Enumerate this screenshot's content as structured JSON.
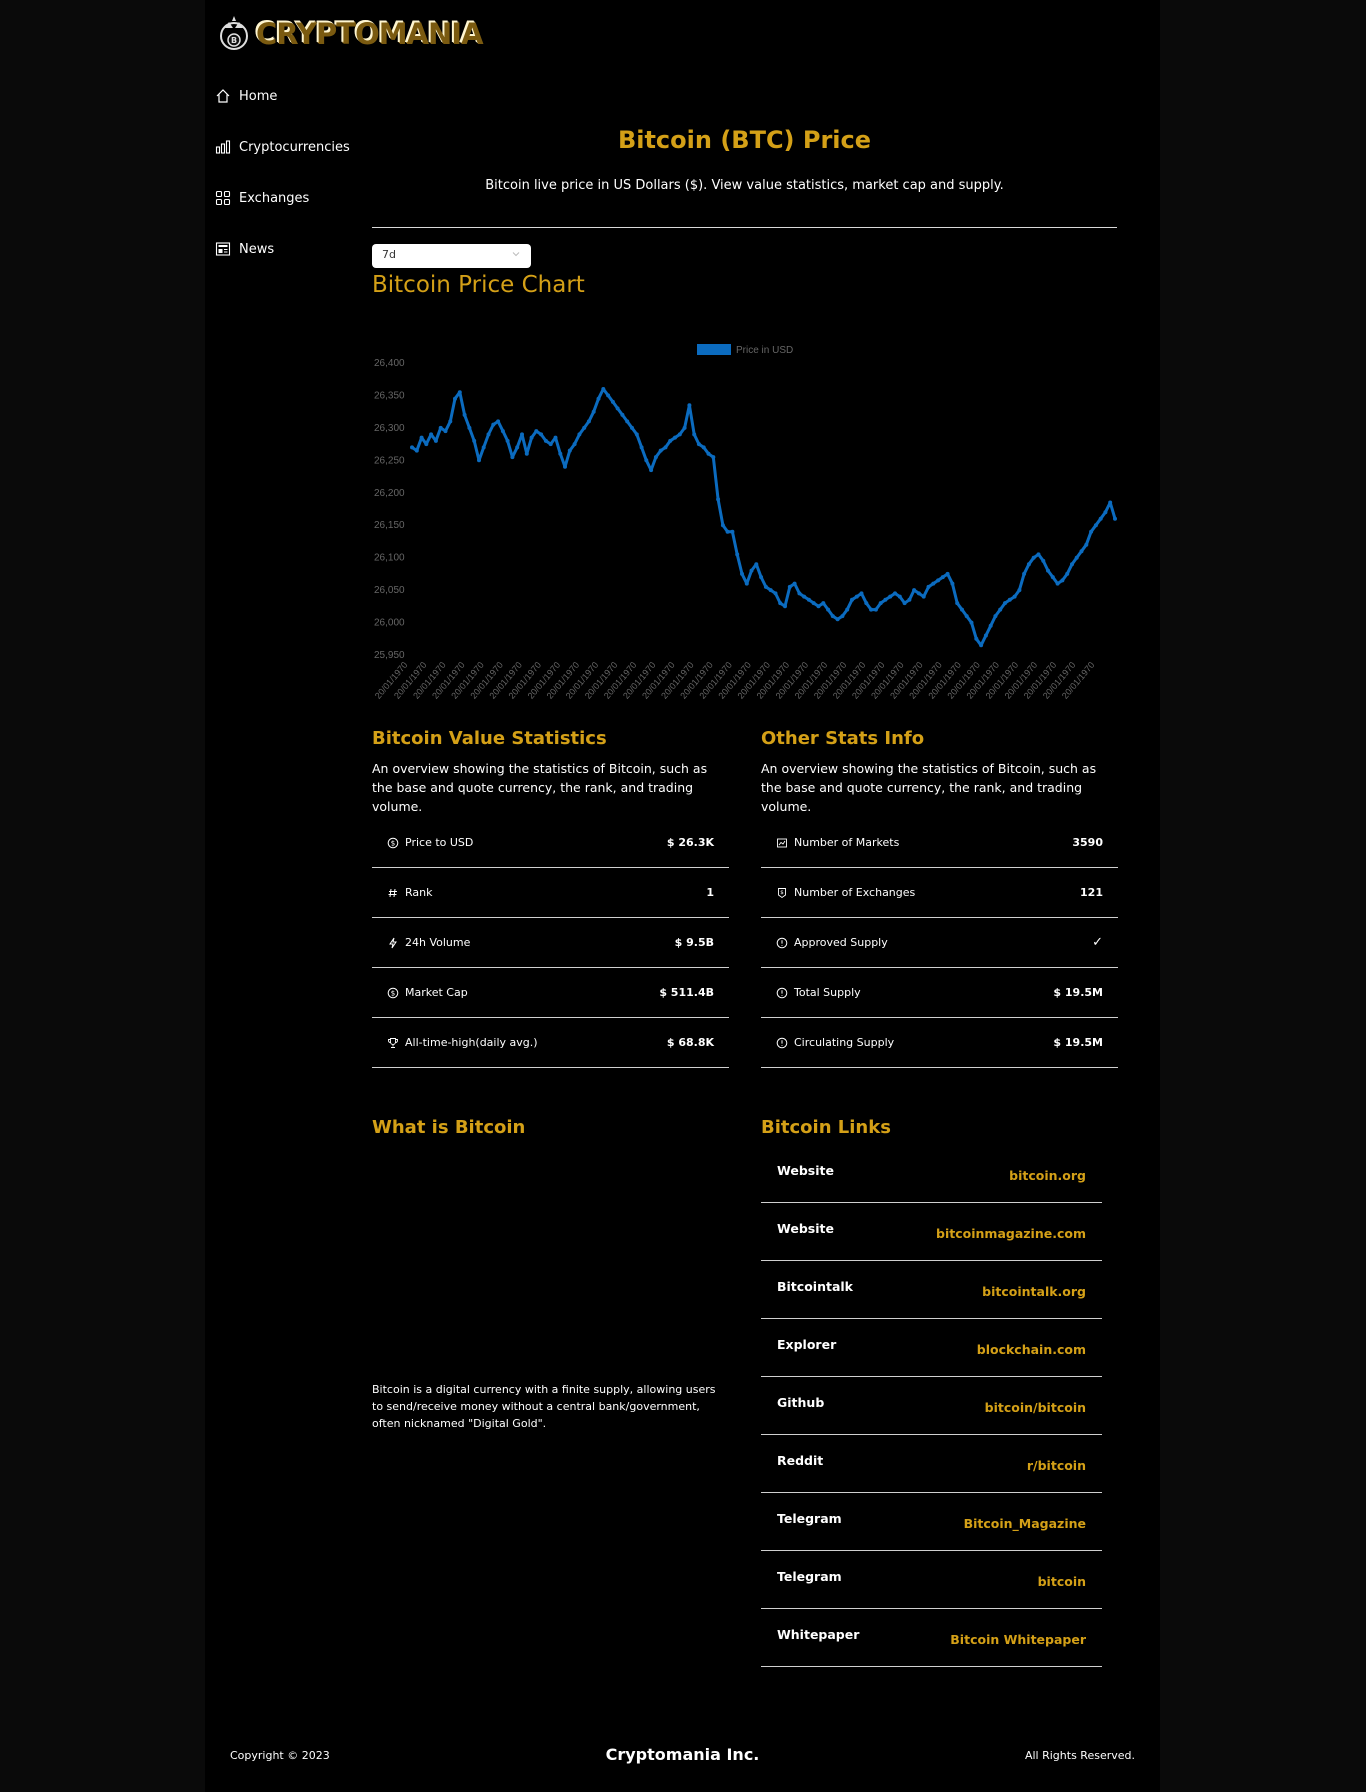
{
  "brand": {
    "logo_text": "CRYPTOMANIA"
  },
  "nav": [
    {
      "label": "Home",
      "icon": "home-icon"
    },
    {
      "label": "Cryptocurrencies",
      "icon": "bar-chart-icon"
    },
    {
      "label": "Exchanges",
      "icon": "grid-icon"
    },
    {
      "label": "News",
      "icon": "newspaper-icon"
    }
  ],
  "header": {
    "title": "Bitcoin (BTC) Price",
    "subtitle": "Bitcoin live price in US Dollars ($). View value statistics, market cap and supply."
  },
  "period_select": {
    "value": "7d"
  },
  "chart_section": {
    "title": "Bitcoin Price Chart"
  },
  "chart_data": {
    "type": "line",
    "title": "",
    "legend": {
      "label": "Price in USD",
      "position": "top"
    },
    "ylim": [
      25950,
      26400
    ],
    "yticks": [
      "26,400",
      "26,350",
      "26,300",
      "26,250",
      "26,200",
      "26,150",
      "26,100",
      "26,050",
      "26,000",
      "25,950"
    ],
    "xtick_label": "20/01/1970",
    "xtick_count": 37,
    "series": [
      {
        "name": "Price in USD",
        "color": "#0b6bbf",
        "values": [
          26270,
          26265,
          26285,
          26275,
          26290,
          26280,
          26300,
          26295,
          26310,
          26345,
          26355,
          26320,
          26300,
          26280,
          26250,
          26270,
          26290,
          26305,
          26310,
          26295,
          26280,
          26255,
          26270,
          26290,
          26260,
          26285,
          26295,
          26290,
          26280,
          26275,
          26285,
          26260,
          26240,
          26265,
          26275,
          26290,
          26300,
          26310,
          26325,
          26345,
          26360,
          26350,
          26340,
          26330,
          26320,
          26310,
          26300,
          26290,
          26270,
          26250,
          26235,
          26255,
          26265,
          26270,
          26280,
          26285,
          26290,
          26300,
          26335,
          26290,
          26275,
          26270,
          26260,
          26255,
          26190,
          26150,
          26140,
          26140,
          26105,
          26075,
          26060,
          26080,
          26090,
          26070,
          26055,
          26050,
          26045,
          26030,
          26025,
          26055,
          26060,
          26045,
          26040,
          26035,
          26030,
          26025,
          26030,
          26020,
          26010,
          26005,
          26010,
          26020,
          26035,
          26040,
          26045,
          26030,
          26020,
          26020,
          26030,
          26035,
          26040,
          26045,
          26040,
          26030,
          26035,
          26050,
          26045,
          26040,
          26055,
          26060,
          26065,
          26070,
          26075,
          26060,
          26030,
          26020,
          26010,
          26000,
          25975,
          25965,
          25980,
          25995,
          26010,
          26020,
          26030,
          26035,
          26040,
          26050,
          26075,
          26090,
          26100,
          26105,
          26095,
          26080,
          26070,
          26060,
          26065,
          26075,
          26090,
          26100,
          26110,
          26120,
          26140,
          26150,
          26160,
          26170,
          26185,
          26160
        ]
      }
    ]
  },
  "value_stats": {
    "title": "Bitcoin Value Statistics",
    "description": "An overview showing the statistics of Bitcoin, such as the base and quote currency, the rank, and trading volume.",
    "rows": [
      {
        "label": "Price to USD",
        "value": "$ 26.3K",
        "icon": "dollar-circle-icon"
      },
      {
        "label": "Rank",
        "value": "1",
        "icon": "hash-icon"
      },
      {
        "label": "24h Volume",
        "value": "$ 9.5B",
        "icon": "bolt-icon"
      },
      {
        "label": "Market Cap",
        "value": "$ 511.4B",
        "icon": "dollar-circle-icon"
      },
      {
        "label": "All-time-high(daily avg.)",
        "value": "$ 68.8K",
        "icon": "trophy-icon"
      }
    ]
  },
  "other_stats": {
    "title": "Other Stats Info",
    "description": "An overview showing the statistics of Bitcoin, such as the base and quote currency, the rank, and trading volume.",
    "rows": [
      {
        "label": "Number of Markets",
        "value": "3590",
        "icon": "fund-icon"
      },
      {
        "label": "Number of Exchanges",
        "value": "121",
        "icon": "money-collect-icon"
      },
      {
        "label": "Approved Supply",
        "value": "✓",
        "icon": "exclamation-circle-icon"
      },
      {
        "label": "Total Supply",
        "value": "$ 19.5M",
        "icon": "exclamation-circle-icon"
      },
      {
        "label": "Circulating Supply",
        "value": "$ 19.5M",
        "icon": "exclamation-circle-icon"
      }
    ]
  },
  "about": {
    "title": "What is Bitcoin",
    "text": "Bitcoin is a digital currency with a finite supply, allowing users to send/receive money without a central bank/government, often nicknamed \"Digital Gold\"."
  },
  "links": {
    "title": "Bitcoin Links",
    "items": [
      {
        "name": "Website",
        "url": "bitcoin.org"
      },
      {
        "name": "Website",
        "url": "bitcoinmagazine.com"
      },
      {
        "name": "Bitcointalk",
        "url": "bitcointalk.org"
      },
      {
        "name": "Explorer",
        "url": "blockchain.com"
      },
      {
        "name": "Github",
        "url": "bitcoin/bitcoin"
      },
      {
        "name": "Reddit",
        "url": "r/bitcoin"
      },
      {
        "name": "Telegram",
        "url": "Bitcoin_Magazine"
      },
      {
        "name": "Telegram",
        "url": "bitcoin"
      },
      {
        "name": "Whitepaper",
        "url": "Bitcoin Whitepaper"
      }
    ]
  },
  "footer": {
    "copyright": "Copyright © 2023",
    "brand": "Cryptomania Inc.",
    "rights": "All Rights Reserved."
  },
  "colors": {
    "accent": "#d4a017",
    "line": "#0b6bbf",
    "background": "#000000"
  }
}
